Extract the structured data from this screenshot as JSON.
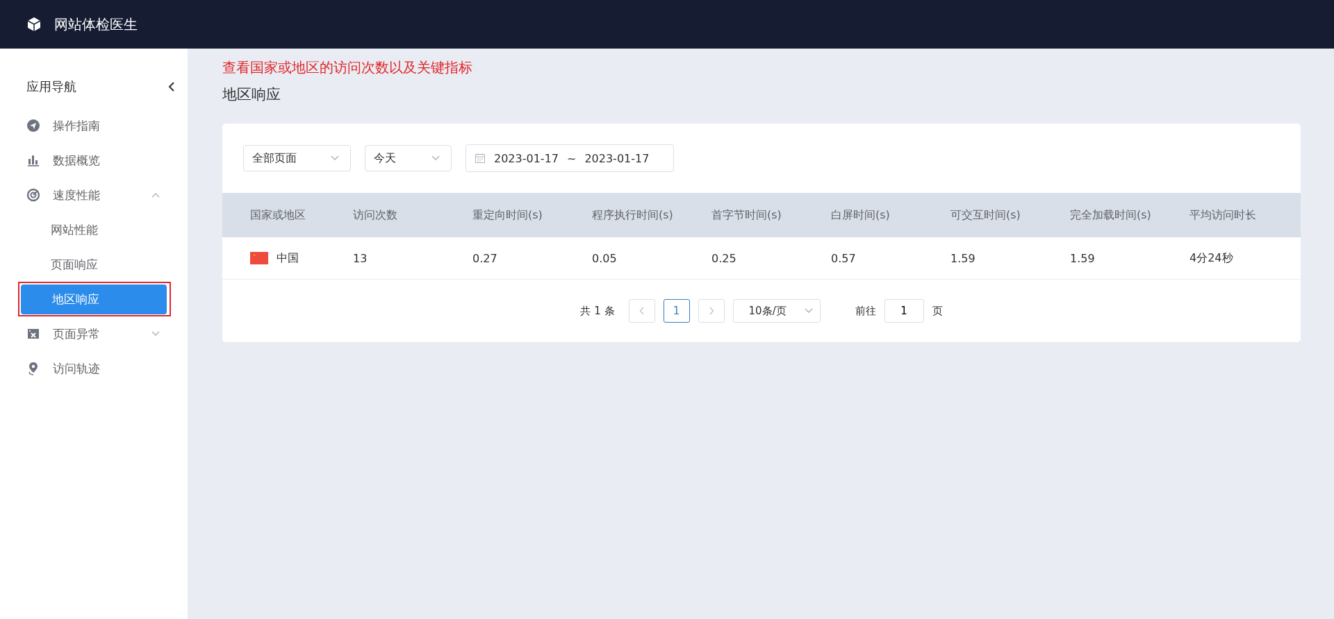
{
  "header": {
    "title": "网站体检医生"
  },
  "sidebar": {
    "title": "应用导航",
    "items": [
      {
        "kind": "link",
        "label": "操作指南"
      },
      {
        "kind": "link",
        "label": "数据概览"
      },
      {
        "kind": "group",
        "label": "速度性能",
        "expanded": true,
        "children": [
          {
            "label": "网站性能",
            "selected": false,
            "highlighted": false
          },
          {
            "label": "页面响应",
            "selected": false,
            "highlighted": false
          },
          {
            "label": "地区响应",
            "selected": true,
            "highlighted": true
          }
        ]
      },
      {
        "kind": "group",
        "label": "页面异常",
        "expanded": false
      },
      {
        "kind": "link",
        "label": "访问轨迹"
      }
    ]
  },
  "annotation": {
    "text": "查看国家或地区的访问次数以及关键指标"
  },
  "page_title": "地区响应",
  "filters": {
    "page_select": "全部页面",
    "range_select": "今天",
    "date_start": "2023-01-17",
    "date_separator": "~",
    "date_end": "2023-01-17"
  },
  "table": {
    "columns": [
      "国家或地区",
      "访问次数",
      "重定向时间(s)",
      "程序执行时间(s)",
      "首字节时间(s)",
      "白屏时间(s)",
      "可交互时间(s)",
      "完全加载时间(s)",
      "平均访问时长"
    ],
    "rows": [
      {
        "cells": [
          "中国",
          "13",
          "0.27",
          "0.05",
          "0.25",
          "0.57",
          "1.59",
          "1.59",
          "4分24秒"
        ]
      }
    ]
  },
  "pagination": {
    "total": "共 1 条",
    "pages": [
      {
        "label": "1",
        "selected": true
      }
    ],
    "page_size": "10条/页",
    "jump_label": "前往",
    "jump_value": "1",
    "jump_suffix": "页"
  }
}
